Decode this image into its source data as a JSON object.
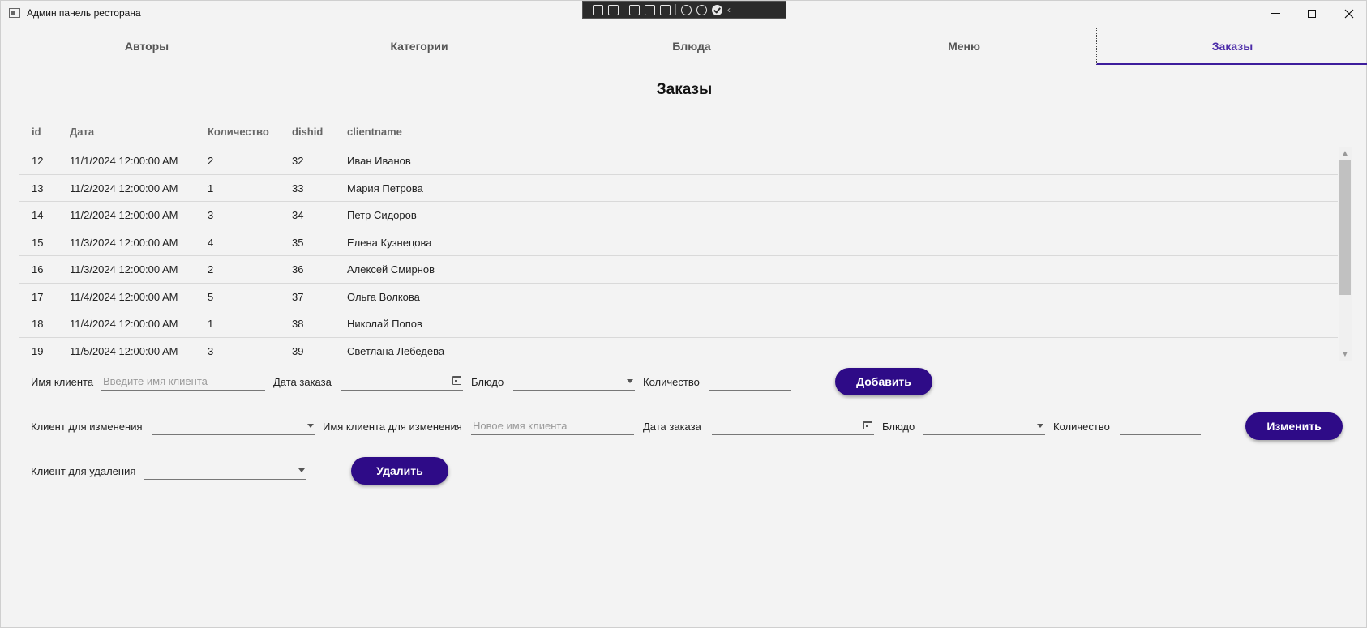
{
  "window": {
    "title": "Админ панель ресторана"
  },
  "tabs": [
    {
      "label": "Авторы"
    },
    {
      "label": "Категории"
    },
    {
      "label": "Блюда"
    },
    {
      "label": "Меню"
    },
    {
      "label": "Заказы"
    }
  ],
  "active_tab": "Заказы",
  "section": {
    "title": "Заказы"
  },
  "table": {
    "headers": {
      "id": "id",
      "date": "Дата",
      "qty": "Количество",
      "dish": "dishid",
      "client": "clientname"
    },
    "rows": [
      {
        "id": "12",
        "date": "11/1/2024 12:00:00 AM",
        "qty": "2",
        "dish": "32",
        "client": "Иван Иванов"
      },
      {
        "id": "13",
        "date": "11/2/2024 12:00:00 AM",
        "qty": "1",
        "dish": "33",
        "client": "Мария Петрова"
      },
      {
        "id": "14",
        "date": "11/2/2024 12:00:00 AM",
        "qty": "3",
        "dish": "34",
        "client": "Петр Сидоров"
      },
      {
        "id": "15",
        "date": "11/3/2024 12:00:00 AM",
        "qty": "4",
        "dish": "35",
        "client": "Елена Кузнецова"
      },
      {
        "id": "16",
        "date": "11/3/2024 12:00:00 AM",
        "qty": "2",
        "dish": "36",
        "client": "Алексей Смирнов"
      },
      {
        "id": "17",
        "date": "11/4/2024 12:00:00 AM",
        "qty": "5",
        "dish": "37",
        "client": "Ольга Волкова"
      },
      {
        "id": "18",
        "date": "11/4/2024 12:00:00 AM",
        "qty": "1",
        "dish": "38",
        "client": "Николай Попов"
      },
      {
        "id": "19",
        "date": "11/5/2024 12:00:00 AM",
        "qty": "3",
        "dish": "39",
        "client": "Светлана Лебедева"
      }
    ]
  },
  "add_form": {
    "client_label": "Имя клиента",
    "client_placeholder": "Введите имя клиента",
    "date_label": "Дата заказа",
    "dish_label": "Блюдо",
    "qty_label": "Количество",
    "button": "Добавить"
  },
  "edit_form": {
    "select_label": "Клиент для изменения",
    "name_label": "Имя клиента для изменения",
    "name_placeholder": "Новое имя клиента",
    "date_label": "Дата заказа",
    "dish_label": "Блюдо",
    "qty_label": "Количество",
    "button": "Изменить"
  },
  "delete_form": {
    "select_label": "Клиент для удаления",
    "button": "Удалить"
  },
  "colors": {
    "accent": "#2e0b87",
    "active_tab_text": "#4b2ba8",
    "background": "#f3f3f3"
  }
}
